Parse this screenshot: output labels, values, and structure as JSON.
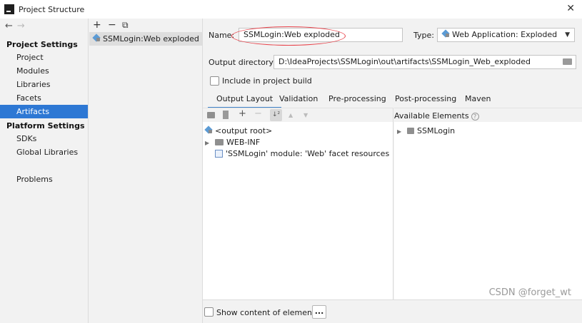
{
  "window": {
    "title": "Project Structure",
    "close_glyph": "✕"
  },
  "nav": {
    "back_glyph": "←",
    "forward_glyph": "→",
    "project_settings_heading": "Project Settings",
    "project_items": [
      {
        "label": "Project"
      },
      {
        "label": "Modules"
      },
      {
        "label": "Libraries"
      },
      {
        "label": "Facets"
      },
      {
        "label": "Artifacts"
      }
    ],
    "platform_settings_heading": "Platform Settings",
    "platform_items": [
      {
        "label": "SDKs"
      },
      {
        "label": "Global Libraries"
      }
    ],
    "problems_label": "Problems",
    "selected": "Artifacts"
  },
  "artifacts": {
    "add_glyph": "+",
    "remove_glyph": "−",
    "copy_glyph": "⧉",
    "items": [
      {
        "label": "SSMLogin:Web exploded",
        "icon": "web-artifact-icon"
      }
    ]
  },
  "editor": {
    "name_label": "Name:",
    "name_value": "SSMLogin:Web exploded",
    "type_label": "Type:",
    "type_value": "Web Application: Exploded",
    "output_dir_label": "Output directory:",
    "output_dir_value": "D:\\IdeaProjects\\SSMLogin\\out\\artifacts\\SSMLogin_Web_exploded",
    "include_build_label": "Include in project build",
    "tabs": [
      {
        "label": "Output Layout"
      },
      {
        "label": "Validation"
      },
      {
        "label": "Pre-processing"
      },
      {
        "label": "Post-processing"
      },
      {
        "label": "Maven"
      }
    ],
    "active_tab": "Output Layout"
  },
  "layout_tree": {
    "toolbar_icons": [
      "new-folder-icon",
      "archive-icon",
      "add-icon",
      "remove-icon",
      "sort-icon",
      "move-up-icon",
      "move-down-icon"
    ],
    "add_glyph": "+",
    "remove_glyph": "−",
    "sort_glyph": "↓²",
    "up_glyph": "▲",
    "down_glyph": "▼",
    "nodes": [
      {
        "label": "<output root>"
      },
      {
        "label": "WEB-INF"
      },
      {
        "label": "'SSMLogin' module: 'Web' facet resources"
      }
    ]
  },
  "available": {
    "heading": "Available Elements",
    "help_glyph": "?",
    "nodes": [
      {
        "label": "SSMLogin"
      }
    ]
  },
  "bottom": {
    "show_content_label": "Show content of elements",
    "more_label": "..."
  },
  "watermark": "CSDN @forget_wt",
  "colors": {
    "selection": "#2e78d4",
    "active_tab_underline": "#4083c9",
    "annotation_oval": "#e8424a"
  }
}
